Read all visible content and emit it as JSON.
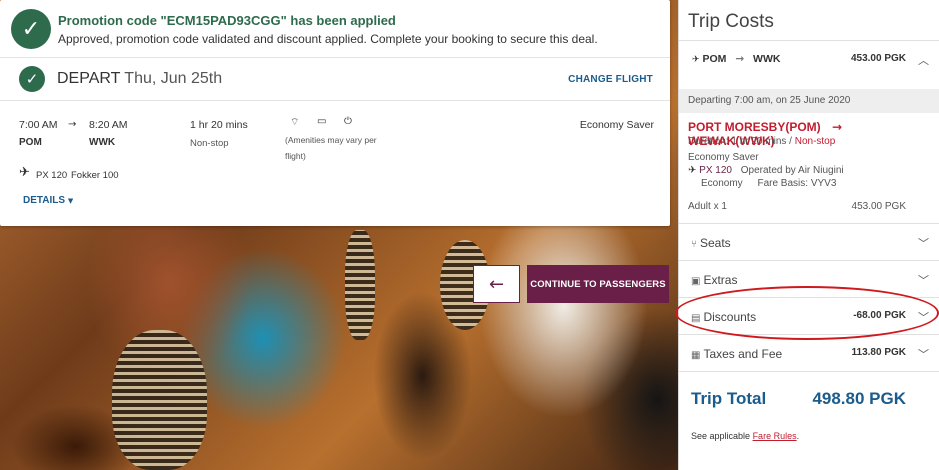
{
  "promo": {
    "title": "Promotion code \"ECM15PAD93CGG\" has been applied",
    "subtitle": "Approved, promotion code validated and discount applied. Complete your booking to secure this deal.",
    "check_icon": "check-icon"
  },
  "depart": {
    "label": "DEPART",
    "date": "Thu, Jun 25th",
    "change_flight": "CHANGE FLIGHT"
  },
  "segment": {
    "dep_time": "7:00 AM",
    "arr_time": "8:20 AM",
    "dep_code": "POM",
    "arr_code": "WWK",
    "duration": "1 hr 20 mins",
    "stops": "Non-stop",
    "amenities": [
      "wifi-icon",
      "power-outlet-icon",
      "power-icon"
    ],
    "amenities_note_1": "(Amenities may vary per",
    "amenities_note_2": "flight)",
    "fare_class": "Economy Saver",
    "flight_no": "PX 120",
    "aircraft": "Fokker 100",
    "details_link": "DETAILS"
  },
  "actions": {
    "continue_label": "CONTINUE TO PASSENGERS"
  },
  "trip": {
    "title": "Trip Costs",
    "route_from": "POM",
    "route_to": "WWK",
    "route_price": "453.00 PGK",
    "departing_line": "Departing 7:00 am, on 25 June 2020",
    "from_city": "PORT MORESBY(POM)",
    "to_city": "WEWAK(WWK)",
    "duration_text": "Duration: 1 hr 20 mins /",
    "stops_text": "Non-stop",
    "fare_family": "Economy Saver",
    "flight_no": "PX 120",
    "operated_by": "Operated by Air Niugini",
    "cabin": "Economy",
    "fare_basis": "Fare Basis: VYV3",
    "pax": "Adult x 1",
    "pax_price": "453.00 PGK",
    "seats_label": "Seats",
    "extras_label": "Extras",
    "discounts_label": "Discounts",
    "discounts_value": "-68.00 PGK",
    "taxes_label": "Taxes and Fee",
    "taxes_value": "113.80 PGK",
    "total_label": "Trip Total",
    "total_value": "498.80 PGK",
    "fare_note_prefix": "See applicable",
    "fare_rules": "Fare Rules",
    "fare_note_suffix": "."
  },
  "colors": {
    "brand_purple": "#6a1f48",
    "link_blue": "#1b5c8c",
    "success_green": "#2e6b4d",
    "alert_red": "#c21d2f"
  }
}
